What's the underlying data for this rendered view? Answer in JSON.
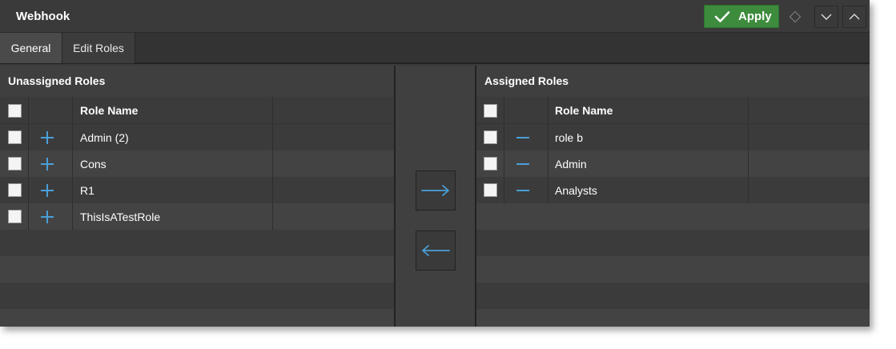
{
  "header": {
    "title": "Webhook",
    "apply_label": "Apply"
  },
  "tabs": [
    {
      "label": "General",
      "active": true
    },
    {
      "label": "Edit Roles",
      "active": false
    }
  ],
  "unassigned": {
    "title": "Unassigned Roles",
    "column_header": "Role Name",
    "rows": [
      {
        "name": "Admin (2)"
      },
      {
        "name": "Cons"
      },
      {
        "name": "R1"
      },
      {
        "name": "ThisIsATestRole"
      }
    ]
  },
  "assigned": {
    "title": "Assigned Roles",
    "column_header": "Role Name",
    "rows": [
      {
        "name": "role b"
      },
      {
        "name": "Admin"
      },
      {
        "name": "Analysts"
      }
    ]
  },
  "colors": {
    "accent_blue": "#4a9fd8",
    "apply_green": "#3d8b3d"
  },
  "icons": {
    "apply": "check-icon",
    "add": "plus-icon",
    "remove": "minus-icon",
    "move_right": "arrow-right-icon",
    "move_left": "arrow-left-icon"
  }
}
